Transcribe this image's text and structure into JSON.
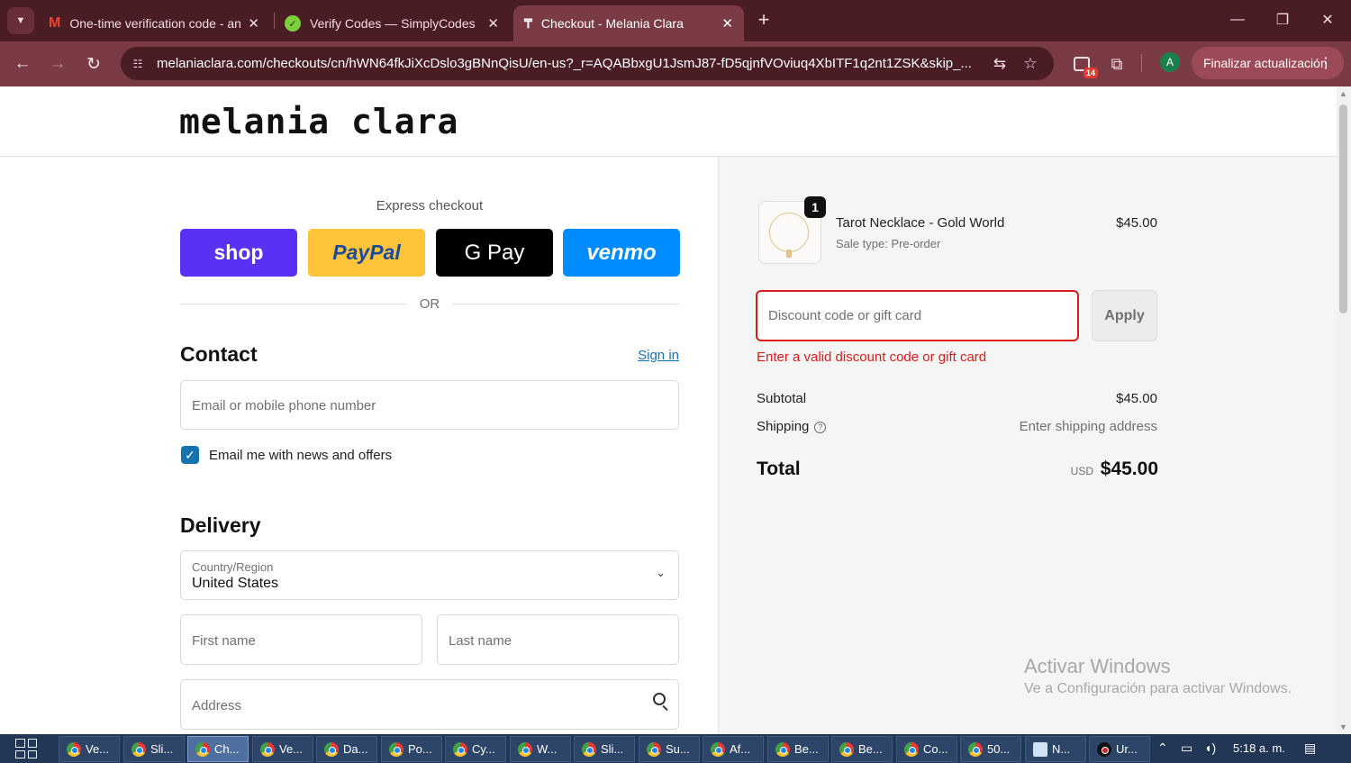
{
  "browser": {
    "tabs": [
      {
        "title": "One-time verification code - an",
        "icon": "gmail-icon"
      },
      {
        "title": "Verify Codes — SimplyCodes",
        "icon": "simplycodes-icon"
      },
      {
        "title": "Checkout - Melania Clara",
        "icon": "melania-clara-icon"
      }
    ],
    "url": "melaniaclara.com/checkouts/cn/hWN64fkJiXcDslo3gBNnQisU/en-us?_r=AQABbxgU1JsmJ87-fD5qjnfVOviuq4XbITF1q2nt1ZSK&skip_...",
    "extension_badge": "14",
    "profile_initial": "A",
    "update_button": "Finalizar actualización"
  },
  "store": {
    "logo": "melania clara"
  },
  "checkout": {
    "express_title": "Express checkout",
    "express_buttons": [
      {
        "label": "shop",
        "color": "#5a31f4"
      },
      {
        "label": "PayPal",
        "color": "#ffc439"
      },
      {
        "label": "G Pay",
        "color": "#000000"
      },
      {
        "label": "venmo",
        "color": "#008cff"
      }
    ],
    "or_text": "OR",
    "contact": {
      "heading": "Contact",
      "sign_in": "Sign in",
      "email_placeholder": "Email or mobile phone number",
      "newsletter_label": "Email me with news and offers",
      "newsletter_checked": true
    },
    "delivery": {
      "heading": "Delivery",
      "country_label": "Country/Region",
      "country_value": "United States",
      "first_name_placeholder": "First name",
      "last_name_placeholder": "Last name",
      "address_placeholder": "Address"
    }
  },
  "summary": {
    "item": {
      "name": "Tarot Necklace - Gold World",
      "meta": "Sale type: Pre-order",
      "price": "$45.00",
      "quantity": "1"
    },
    "discount_placeholder": "Discount code or gift card",
    "apply_label": "Apply",
    "error": "Enter a valid discount code or gift card",
    "subtotal_label": "Subtotal",
    "subtotal_value": "$45.00",
    "shipping_label": "Shipping",
    "shipping_value": "Enter shipping address",
    "total_label": "Total",
    "total_currency": "USD",
    "total_value": "$45.00"
  },
  "watermark": {
    "line1": "Activar Windows",
    "line2": "Ve a Configuración para activar Windows."
  },
  "taskbar": {
    "items": [
      "Ve...",
      "Sli...",
      "Ch...",
      "Ve...",
      "Da...",
      "Po...",
      "Cy...",
      "W...",
      "Sli...",
      "Su...",
      "Af...",
      "Be...",
      "Be...",
      "Co...",
      "50...",
      "N...",
      "Ur..."
    ],
    "clock": "5:18 a. m."
  },
  "colors": {
    "browser_frame": "#4a1c24",
    "toolbar": "#7b3b45",
    "link": "#1773b0",
    "error": "#dd1d1d"
  }
}
